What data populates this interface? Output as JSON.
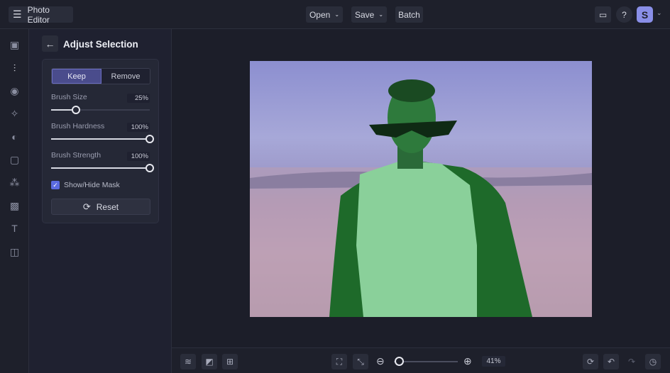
{
  "app": {
    "title": "Photo Editor",
    "avatar_letter": "S"
  },
  "menu": {
    "open": "Open",
    "save": "Save",
    "batch": "Batch"
  },
  "panel": {
    "title": "Adjust Selection",
    "keep": "Keep",
    "remove": "Remove",
    "sliders": [
      {
        "label": "Brush Size",
        "value": "25%",
        "fraction": 0.25
      },
      {
        "label": "Brush Hardness",
        "value": "100%",
        "fraction": 1.0
      },
      {
        "label": "Brush Strength",
        "value": "100%",
        "fraction": 1.0
      }
    ],
    "mask_label": "Show/Hide Mask",
    "mask_checked": true,
    "reset": "Reset"
  },
  "zoom": {
    "value": "41%",
    "fraction": 0.08
  },
  "colors": {
    "accent": "#4a4c8c",
    "checkbox": "#5b6be0",
    "mask_green": "#1f6b2a"
  }
}
